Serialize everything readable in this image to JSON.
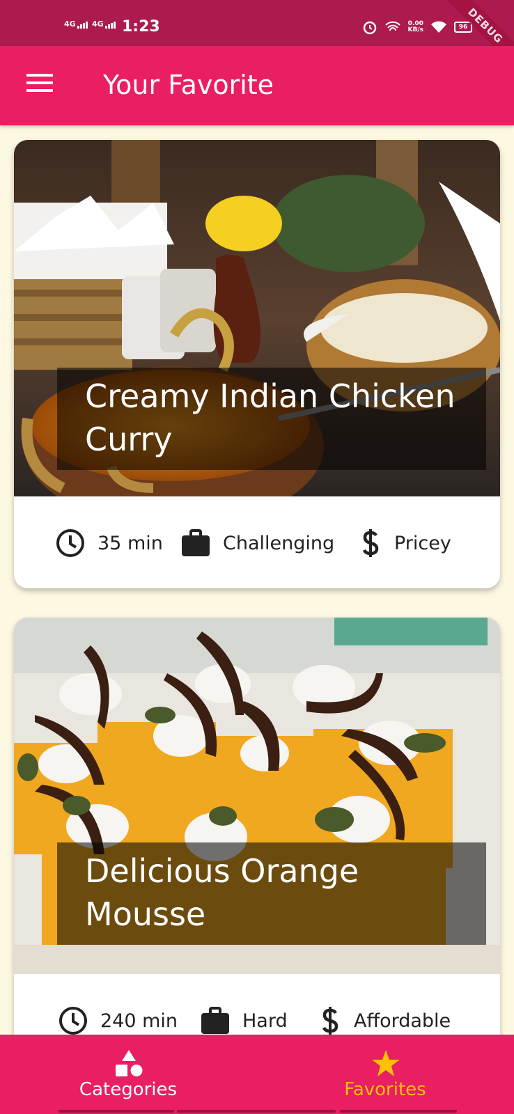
{
  "status_bar": {
    "network_1": "4G",
    "network_2": "4G",
    "time": "1:23",
    "data_speed_value": "0.00",
    "data_speed_unit": "KB/s",
    "battery": "96",
    "debug_label": "DEBUG"
  },
  "app_bar": {
    "title": "Your Favorite",
    "menu_icon": "hamburger-menu-icon"
  },
  "meals": [
    {
      "title": "Creamy Indian Chicken Curry",
      "duration": "35 min",
      "complexity": "Challenging",
      "affordability": "Pricey"
    },
    {
      "title": "Delicious Orange Mousse",
      "duration": "240 min",
      "complexity": "Hard",
      "affordability": "Affordable"
    }
  ],
  "bottom_nav": {
    "items": [
      {
        "label": "Categories",
        "icon": "category-shapes-icon",
        "selected": false
      },
      {
        "label": "Favorites",
        "icon": "star-icon",
        "selected": true
      }
    ]
  },
  "colors": {
    "primary": "#e91e63",
    "status_bar": "#ad1a50",
    "background": "#fdf8e1",
    "accent": "#ffc107"
  }
}
